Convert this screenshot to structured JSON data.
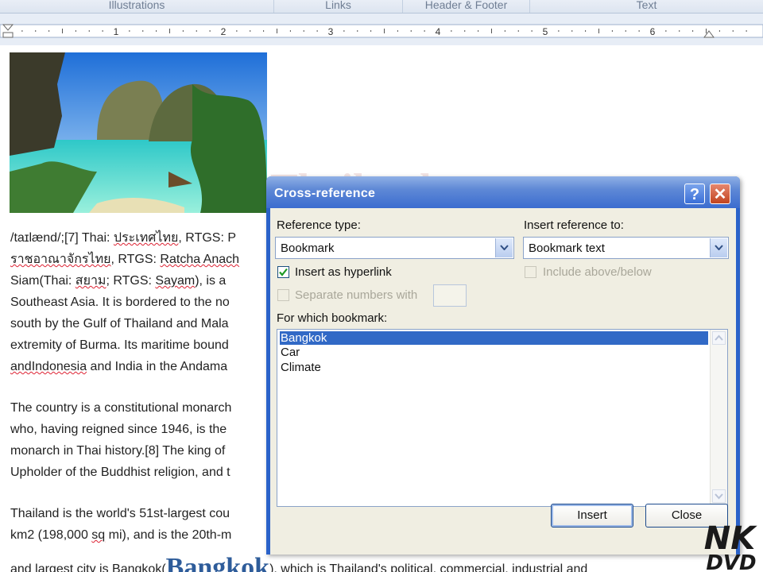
{
  "ribbon": {
    "groups": [
      "Illustrations",
      "Links",
      "Header & Footer",
      "Text"
    ]
  },
  "ruler": {
    "numbers": [
      "1",
      "2",
      "3",
      "4",
      "5",
      "6"
    ]
  },
  "document": {
    "lines1": [
      [
        "/taɪlænd/;[7] Thai: ",
        "ประเทศไทย",
        ", RTGS: P"
      ],
      [
        "",
        "ราชอาณาจักรไทย",
        ", RTGS: ",
        "Ratcha Anach"
      ],
      [
        "Siam(Thai: ",
        "สยาม",
        "; RTGS: ",
        "Sayam",
        "), is a"
      ],
      [
        "Southeast Asia. It is bordered to the no"
      ],
      [
        "south by the Gulf of Thailand and Mala"
      ],
      [
        "extremity of Burma. Its maritime bound"
      ],
      [
        "andIndonesia",
        " and India in the Andama"
      ]
    ],
    "lines2": [
      "The country is a constitutional monarch",
      "who, having reigned since 1946, is the",
      "monarch in Thai history.[8] The king of",
      "Upholder of the Buddhist religion, and t"
    ],
    "lines3": [
      "Thailand is the world's 51st-largest cou",
      [
        "km2 (198,000 ",
        "sq",
        " mi), and is the 20th-m"
      ]
    ],
    "last_line_start": "and largest city is Bangkok(",
    "bangkok_word": "Bangkok",
    "last_line_end": "), which is Thailand's political, commercial, industrial and",
    "behind_title_fragment": "Thailand"
  },
  "dialog": {
    "title": "Cross-reference",
    "help_glyph": "?",
    "close_glyph": "✕",
    "reference_type_label": "Reference type:",
    "reference_type_value": "Bookmark",
    "insert_reference_label": "Insert reference to:",
    "insert_reference_value": "Bookmark text",
    "insert_hyperlink_label": "Insert as hyperlink",
    "insert_hyperlink_checked": true,
    "include_above_below_label": "Include above/below",
    "include_above_below_checked": false,
    "separate_numbers_label": "Separate numbers with",
    "separate_numbers_checked": false,
    "which_bookmark_label": "For which bookmark:",
    "bookmarks": [
      "Bangkok",
      "Car",
      "Climate"
    ],
    "selected_bookmark": "Bangkok",
    "insert_button": "Insert",
    "close_button": "Close"
  },
  "watermark": {
    "line1": "NK",
    "line2": "DVD"
  },
  "colors": {
    "title_bar": "#3b6ccf",
    "selection": "#3169c6",
    "dialog_face": "#f0eee2",
    "bangkok_heading": "#2e5c9a"
  }
}
